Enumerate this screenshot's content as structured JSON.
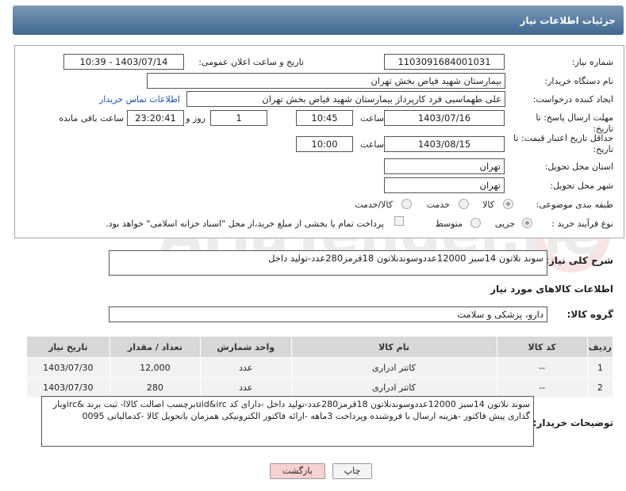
{
  "header": {
    "title": "جزئیات اطلاعات نیاز"
  },
  "form": {
    "need_number_label": "شماره نیاز:",
    "need_number": "1103091684001031",
    "announce_label": "تاریخ و ساعت اعلان عمومی:",
    "announce_value": "1403/07/14 - 10:39",
    "buyer_org_label": "نام دستگاه خریدار:",
    "buyer_org": "بیمارستان شهید فیاض بخش تهران",
    "requester_label": "ایجاد کننده درخواست:",
    "requester": "علی طهماسبی فرد کارپرداز بیمارستان شهید فیاض بخش تهران",
    "contact_link": "اطلاعات تماس خریدار",
    "reply_deadline_label": "مهلت ارسال پاسخ: تا تاریخ:",
    "reply_date": "1403/07/16",
    "time_label": "ساعت",
    "reply_time": "10:45",
    "days_value": "1",
    "days_label": "روز و",
    "remaining_value": "23:20:41",
    "remaining_label": "ساعت باقی مانده",
    "price_validity_label": "حداقل تاریخ اعتبار قیمت: تا تاریخ:",
    "price_date": "1403/08/15",
    "price_time": "10:00",
    "province_label": "استان محل تحویل:",
    "province": "تهران",
    "city_label": "شهر محل تحویل:",
    "city": "تهران",
    "category_label": "طبقه بندی موضوعی:",
    "category_options": [
      "کالا",
      "خدمت",
      "کالا/خدمت"
    ],
    "process_label": "نوع فرآیند خرید :",
    "process_options": [
      "جزیی",
      "متوسط"
    ],
    "payment_note": "پرداخت تمام یا بخشی از مبلغ خرید،از محل \"اسناد خزانه اسلامی\" خواهد بود."
  },
  "summary": {
    "label": "شرح کلی نیاز:",
    "text": "سوند نلاتون 14سبز 12000عددوسوندنلاتون 18قرمز280عدد-تولید داخل"
  },
  "goods": {
    "section_title": "اطلاعات کالاهای مورد نیاز",
    "group_label": "گروه کالا:",
    "group_value": "دارو، پزشکی و سلامت",
    "columns": [
      "ردیف",
      "کد کالا",
      "نام کالا",
      "واحد شمارش",
      "تعداد / مقدار",
      "تاریخ نیاز"
    ],
    "rows": [
      [
        "1",
        "--",
        "کاتتر ادراری",
        "عدد",
        "12,000",
        "1403/07/30"
      ],
      [
        "2",
        "--",
        "کاتتر ادراری",
        "عدد",
        "280",
        "1403/07/30"
      ]
    ]
  },
  "notes": {
    "label": "توضیحات خریدار:",
    "text": "سوند نلاتون 14سبز 12000عددوسوندنلاتون 18قرمز280عدد-تولید داخل -دارای کد uid&ircبرچسب اصالت کالاا- ثبت برند &ircوبار گذاری پیش فاکتور -هزینه ارسال با فروشنده وپرداخت 3ماهه -ارائه فاکتور الکترونیکی همزمان باتحویل کالا -کدمالیاتی 0095"
  },
  "buttons": {
    "print": "چاپ",
    "back": "بازگشت"
  },
  "colors": {
    "header": "#4a7099",
    "link": "#1a50b5",
    "back_button": "#f7d0d0"
  }
}
